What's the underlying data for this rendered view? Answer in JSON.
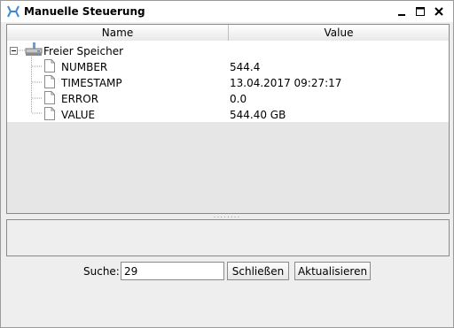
{
  "window": {
    "title": "Manuelle Steuerung"
  },
  "table": {
    "columns": [
      "Name",
      "Value"
    ],
    "root": {
      "label": "Freier Speicher"
    },
    "rows": [
      {
        "name": "NUMBER",
        "value": "544.4"
      },
      {
        "name": "TIMESTAMP",
        "value": "13.04.2017 09:27:17"
      },
      {
        "name": "ERROR",
        "value": "0.0"
      },
      {
        "name": "VALUE",
        "value": "544.40 GB"
      }
    ]
  },
  "splitter": {
    "grip": "........"
  },
  "search": {
    "label": "Suche:",
    "value": "29"
  },
  "buttons": {
    "close_label": "Schließen",
    "refresh_label": "Aktualisieren"
  },
  "colors": {
    "accent": "#3c8ad2",
    "panel_bg": "#e6e6e6",
    "window_bg": "#eeeeee"
  }
}
